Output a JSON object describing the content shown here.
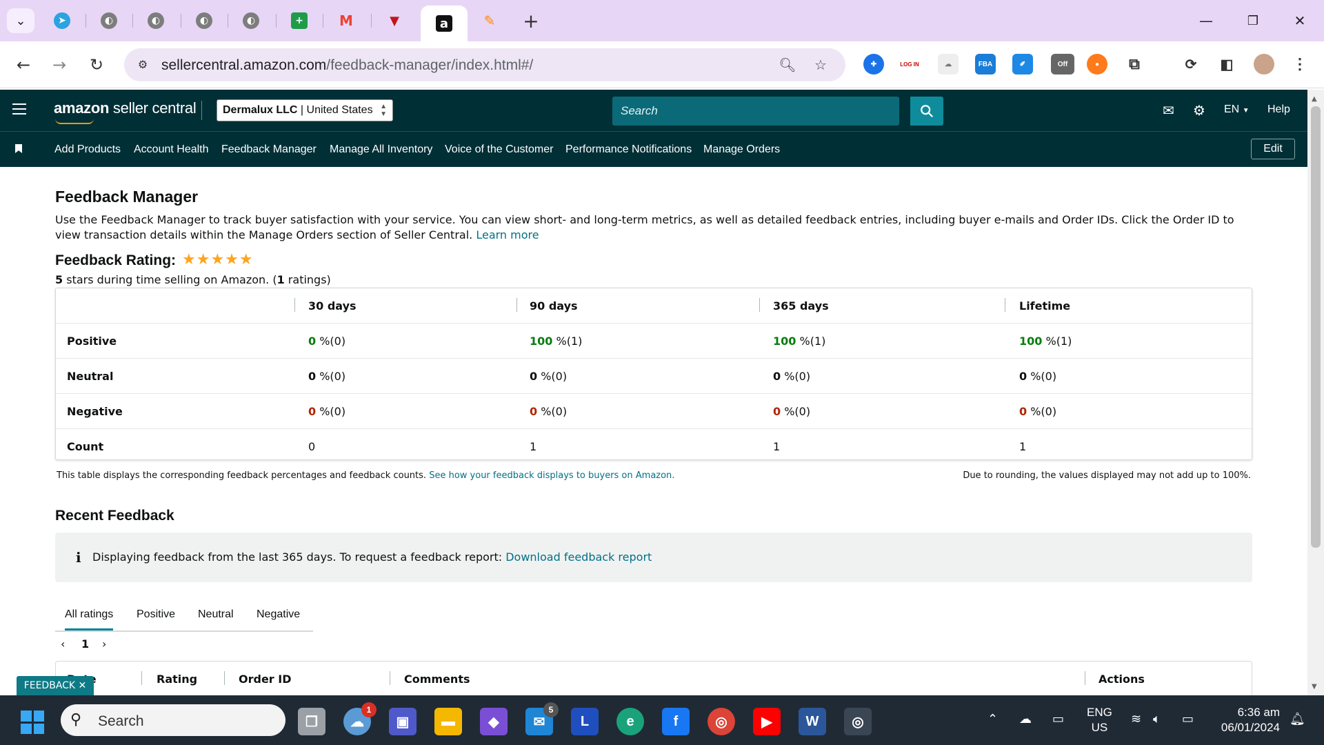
{
  "browser": {
    "tabs": [
      {
        "icon": "telegram-icon",
        "color": "#2aa3e0"
      },
      {
        "icon": "globe-icon",
        "color": "#7d7d7d"
      },
      {
        "icon": "globe-icon",
        "color": "#7d7d7d"
      },
      {
        "icon": "globe-icon",
        "color": "#7d7d7d"
      },
      {
        "icon": "globe-icon",
        "color": "#7d7d7d"
      },
      {
        "icon": "google-sheets-plus-icon",
        "color": "#1e9c4a"
      },
      {
        "icon": "gmail-icon",
        "color": "#ea4335"
      },
      {
        "icon": "triangle-logo-icon",
        "color": "#c0161a"
      },
      {
        "icon": "amazon-icon",
        "color": "#111111",
        "active": true
      },
      {
        "icon": "tasks-app-icon",
        "color": "#ff8a00"
      }
    ],
    "new_tab_symbol": "+",
    "window_controls": {
      "minimize": "—",
      "restore": "❐",
      "close": "✕"
    },
    "url_domain": "sellercentral.amazon.com",
    "url_path": "/feedback-manager/index.html#/",
    "extension_badge": "Off"
  },
  "header": {
    "logo_bold": "amazon",
    "logo_rest": " seller central",
    "account_name": "Dermalux LLC",
    "account_region": "United States",
    "search_placeholder": "Search",
    "language": "EN",
    "help": "Help"
  },
  "nav": {
    "links": [
      "Add Products",
      "Account Health",
      "Feedback Manager",
      "Manage All Inventory",
      "Voice of the Customer",
      "Performance Notifications",
      "Manage Orders"
    ],
    "edit": "Edit"
  },
  "page": {
    "title": "Feedback Manager",
    "description": "Use the Feedback Manager to track buyer satisfaction with your service. You can view short- and long-term metrics, as well as detailed feedback entries, including buyer e-mails and Order IDs. Click the Order ID to view transaction details within the Manage Orders section of Seller Central.",
    "learn_more": "Learn more",
    "rating_heading": "Feedback Rating:",
    "rating_stars": 5,
    "rating_stars_text": "★★★★★",
    "rating_summary_num": "5",
    "rating_summary_text": " stars during time selling on Amazon. (",
    "rating_count": "1",
    "rating_summary_end": " ratings)"
  },
  "table": {
    "columns": [
      "30 days",
      "90 days",
      "365 days",
      "Lifetime"
    ],
    "rows": [
      {
        "label": "Positive",
        "cells": [
          {
            "num": "0",
            "rest": " %(0)"
          },
          {
            "num": "100",
            "rest": " %(1)"
          },
          {
            "num": "100",
            "rest": " %(1)"
          },
          {
            "num": "100",
            "rest": " %(1)"
          }
        ]
      },
      {
        "label": "Neutral",
        "cells": [
          {
            "num": "0",
            "rest": " %(0)"
          },
          {
            "num": "0",
            "rest": " %(0)"
          },
          {
            "num": "0",
            "rest": " %(0)"
          },
          {
            "num": "0",
            "rest": " %(0)"
          }
        ]
      },
      {
        "label": "Negative",
        "cells": [
          {
            "num": "0",
            "rest": " %(0)"
          },
          {
            "num": "0",
            "rest": " %(0)"
          },
          {
            "num": "0",
            "rest": " %(0)"
          },
          {
            "num": "0",
            "rest": " %(0)"
          }
        ]
      },
      {
        "label": "Count",
        "cells": [
          {
            "num": "0",
            "rest": ""
          },
          {
            "num": "1",
            "rest": ""
          },
          {
            "num": "1",
            "rest": ""
          },
          {
            "num": "1",
            "rest": ""
          }
        ]
      }
    ],
    "note_left": "This table displays the corresponding feedback percentages and feedback counts.",
    "note_link": "See how your feedback displays to buyers on Amazon.",
    "note_right": "Due to rounding, the values displayed may not add up to 100%."
  },
  "recent": {
    "title": "Recent Feedback",
    "info_symbol": "i",
    "info_text": "Displaying feedback from the last 365 days. To request a feedback report: ",
    "info_link": "Download feedback report",
    "tabs": [
      "All ratings",
      "Positive",
      "Neutral",
      "Negative"
    ],
    "pager_prev": "‹",
    "pager_page": "1",
    "pager_next": "›",
    "list_columns": [
      "Date",
      "Rating",
      "Order ID",
      "Comments",
      "Actions"
    ]
  },
  "feedback_tag": "FEEDBACK ✕",
  "taskbar": {
    "search_label": "Search",
    "weather_badge": "1",
    "mail_badge": "5",
    "lang_line1": "ENG",
    "lang_line2": "US",
    "time": "6:36 am",
    "date": "06/01/2024"
  }
}
